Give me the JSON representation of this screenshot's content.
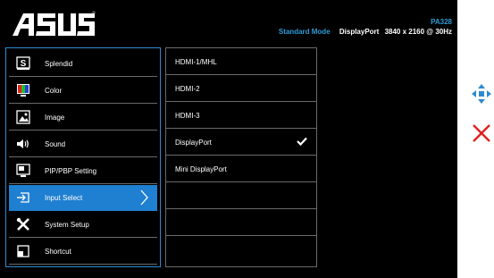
{
  "brand": {
    "logo_text": "ASUS"
  },
  "header": {
    "model": "PA328",
    "mode": "Standard Mode",
    "port": "DisplayPort",
    "resolution": "3840 x 2160 @ 30Hz"
  },
  "menu": {
    "items": [
      {
        "label": "Splendid",
        "icon": "splendid-icon"
      },
      {
        "label": "Color",
        "icon": "color-icon"
      },
      {
        "label": "Image",
        "icon": "image-icon"
      },
      {
        "label": "Sound",
        "icon": "speaker-icon"
      },
      {
        "label": "PIP/PBP Setting",
        "icon": "pip-icon"
      },
      {
        "label": "Input Select",
        "icon": "input-select-icon",
        "selected": true
      },
      {
        "label": "System Setup",
        "icon": "tools-icon"
      },
      {
        "label": "Shortcut",
        "icon": "shortcut-icon"
      }
    ]
  },
  "submenu": {
    "items": [
      {
        "label": "HDMI-1/MHL"
      },
      {
        "label": "HDMI-2"
      },
      {
        "label": "HDMI-3"
      },
      {
        "label": "DisplayPort",
        "checked": true
      },
      {
        "label": "Mini DisplayPort"
      },
      {
        "label": ""
      },
      {
        "label": ""
      },
      {
        "label": ""
      }
    ]
  },
  "controls": {
    "navigate_icon": "directional-pad-icon",
    "close_icon": "close-icon"
  },
  "colors": {
    "accent": "#2e9bd6",
    "selected_bg": "#1f7fd1",
    "close_red": "#e02020",
    "background": "#000000"
  }
}
